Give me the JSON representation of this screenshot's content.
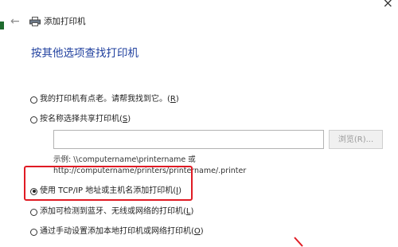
{
  "window": {
    "title": "添加打印机",
    "close_glyph": "×",
    "back_glyph": "←"
  },
  "heading": "按其他选项查找打印机",
  "options": [
    {
      "label": "我的打印机有点老。请帮我找到它。",
      "hotkey": "R",
      "checked": false
    },
    {
      "label": "按名称选择共享打印机",
      "hotkey": "S",
      "checked": false
    },
    {
      "label": "使用 TCP/IP 地址或主机名添加打印机",
      "hotkey": "I",
      "checked": true
    },
    {
      "label": "添加可检测到蓝牙、无线或网络的打印机",
      "hotkey": "L",
      "checked": false
    },
    {
      "label": "通过手动设置添加本地打印机或网络打印机",
      "hotkey": "O",
      "checked": false
    }
  ],
  "share_input": {
    "value": ""
  },
  "browse_button": "浏览(R)...",
  "example": {
    "line1": "示例: \\\\computername\\printername 或",
    "line2": "http://computername/printers/printername/.printer"
  },
  "colors": {
    "heading": "#1f3f9e",
    "highlight": "#e01b24",
    "edge_mark": "#1e6b2e"
  },
  "icons": [
    "back-arrow-icon",
    "printer-icon",
    "close-icon"
  ]
}
